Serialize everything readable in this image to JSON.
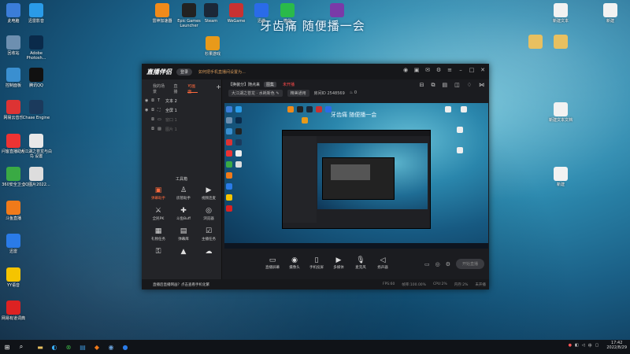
{
  "overlay": {
    "text": "牙齿痛 随便播一会"
  },
  "desktop_left": [
    {
      "label": "此电脑",
      "icon": "computer-icon",
      "color": "#3b7dd8"
    },
    {
      "label": "迅雷影音",
      "icon": "xunlei-icon",
      "color": "#2a9be8"
    },
    {
      "label": "回收站",
      "icon": "recycle-bin-icon",
      "color": "#6d8fb0"
    },
    {
      "label": "Adobe Photosh...",
      "icon": "photoshop-icon",
      "color": "#0a2a4a"
    },
    {
      "label": "控制面板",
      "icon": "control-panel-icon",
      "color": "#3a8fd0"
    },
    {
      "label": "腾讯QQ",
      "icon": "qq-icon",
      "color": "#111"
    },
    {
      "label": "网易云音乐",
      "icon": "netease-music-icon",
      "color": "#d33"
    },
    {
      "label": "Chase Engine",
      "icon": "chase-engine-icon",
      "color": "#1b3a5c"
    },
    {
      "label": "问客直播助手",
      "icon": "live-helper-icon",
      "color": "#e33"
    },
    {
      "label": "大江湖之苍龙与白鸟 设置",
      "icon": "document-icon",
      "color": "#e8e8e8"
    },
    {
      "label": "360安全卫士",
      "icon": "360-icon",
      "color": "#3aaa44"
    },
    {
      "label": "QQ图片2022...",
      "icon": "image-icon",
      "color": "#ddd"
    },
    {
      "label": "斗鱼直播",
      "icon": "douyu-icon",
      "color": "#f07a1a"
    },
    {
      "label": "迅雷",
      "icon": "xunlei-bird-icon",
      "color": "#2a7be8"
    },
    {
      "label": "YY语音",
      "icon": "yy-icon",
      "color": "#f5c400"
    },
    {
      "label": "网易有道词典",
      "icon": "youdao-icon",
      "color": "#d22"
    }
  ],
  "desktop_top": [
    {
      "label": "雷神加速器",
      "icon": "leishen-icon",
      "color": "#f08a1a"
    },
    {
      "label": "Epic Games Launcher",
      "icon": "epic-games-icon",
      "color": "#222"
    },
    {
      "label": "Steam",
      "icon": "steam-icon",
      "color": "#1b2838"
    },
    {
      "label": "WeGame",
      "icon": "wegame-icon",
      "color": "#c83232"
    },
    {
      "label": "迅游",
      "icon": "xunyou-icon",
      "color": "#2a6be8"
    },
    {
      "label": "微信",
      "icon": "wechat-icon",
      "color": "#2aba4a"
    },
    {
      "label": "",
      "icon": "winrar-icon",
      "color": "#7a3aa8"
    },
    {
      "label": "杉果游戏",
      "icon": "sonkwo-icon",
      "color": "#e89a1a"
    }
  ],
  "desktop_right": [
    {
      "label": "新建文本",
      "icon": "text-file-icon"
    },
    {
      "label": "新建",
      "icon": "text-file-icon"
    },
    {
      "label": "",
      "icon": "folder-icon"
    },
    {
      "label": "",
      "icon": "folder-icon"
    },
    {
      "label": "新建文本文档",
      "icon": "text-file-icon"
    },
    {
      "label": "新建",
      "icon": "text-file-icon"
    }
  ],
  "app": {
    "title": "直播伴侣",
    "login": "登录",
    "promo": "如何把手机直播间设置为...",
    "tabs": [
      "我的场景",
      "直播",
      "可画面"
    ],
    "scenes": [
      "文本 2",
      "全屏 1",
      "窗口 1",
      "图片 1"
    ],
    "tools_title": "工具箱",
    "tools": [
      {
        "label": "弹幕助手",
        "icon": "danmaku-icon",
        "hot": true
      },
      {
        "label": "房管助手",
        "icon": "user-icon",
        "hot": false
      },
      {
        "label": "视频连麦",
        "icon": "video-link-icon",
        "hot": false
      },
      {
        "label": "全民PK",
        "icon": "pk-icon",
        "hot": false
      },
      {
        "label": "斗鱼Buff",
        "icon": "buff-icon",
        "hot": false
      },
      {
        "label": "浏览器",
        "icon": "browser-icon",
        "hot": false
      },
      {
        "label": "礼物任务",
        "icon": "gift-task-icon",
        "hot": false
      },
      {
        "label": "弹幕库",
        "icon": "danmaku-lib-icon",
        "hot": false
      },
      {
        "label": "主播任务",
        "icon": "task-icon",
        "hot": false
      },
      {
        "label": "",
        "icon": "key-icon",
        "hot": false
      },
      {
        "label": "",
        "icon": "up-icon",
        "hot": false
      },
      {
        "label": "",
        "icon": "cloud-icon",
        "hot": false
      }
    ],
    "info": {
      "title": "【换装分】随点来",
      "tag": "图集",
      "status": "未开播",
      "category": "大江湖之苍龙 · 水耗新色",
      "edit": "编辑",
      "setting": "精美通用",
      "room_label": "房间ID",
      "room_id": "2548569",
      "hot_count": "0"
    },
    "preview_text": "牙齿痛 随便播一会",
    "controls": [
      {
        "label": "直播屏幕",
        "icon": "screen-icon"
      },
      {
        "label": "摄像头",
        "icon": "camera-icon"
      },
      {
        "label": "手机投屏",
        "icon": "phone-cast-icon"
      },
      {
        "label": "多媒体",
        "icon": "media-icon"
      },
      {
        "label": "麦克风",
        "icon": "mic-icon"
      },
      {
        "label": "扬声器",
        "icon": "speaker-icon"
      }
    ],
    "start_button": "开始直播",
    "status_msg": "直播后直播网画？点击查看手机化繁",
    "stats": [
      "FPS:60",
      "帧率:100.00%",
      "CPU:2%",
      "内存:2%",
      "未开播"
    ]
  },
  "taskbar": {
    "apps": [
      "start-icon",
      "search-icon",
      "file-explorer-icon",
      "edge-icon",
      "xbox-icon",
      "store-icon",
      "douyu-icon",
      "steam-icon",
      "obs-icon"
    ],
    "time": "17:42",
    "date": "2022/8/29"
  }
}
